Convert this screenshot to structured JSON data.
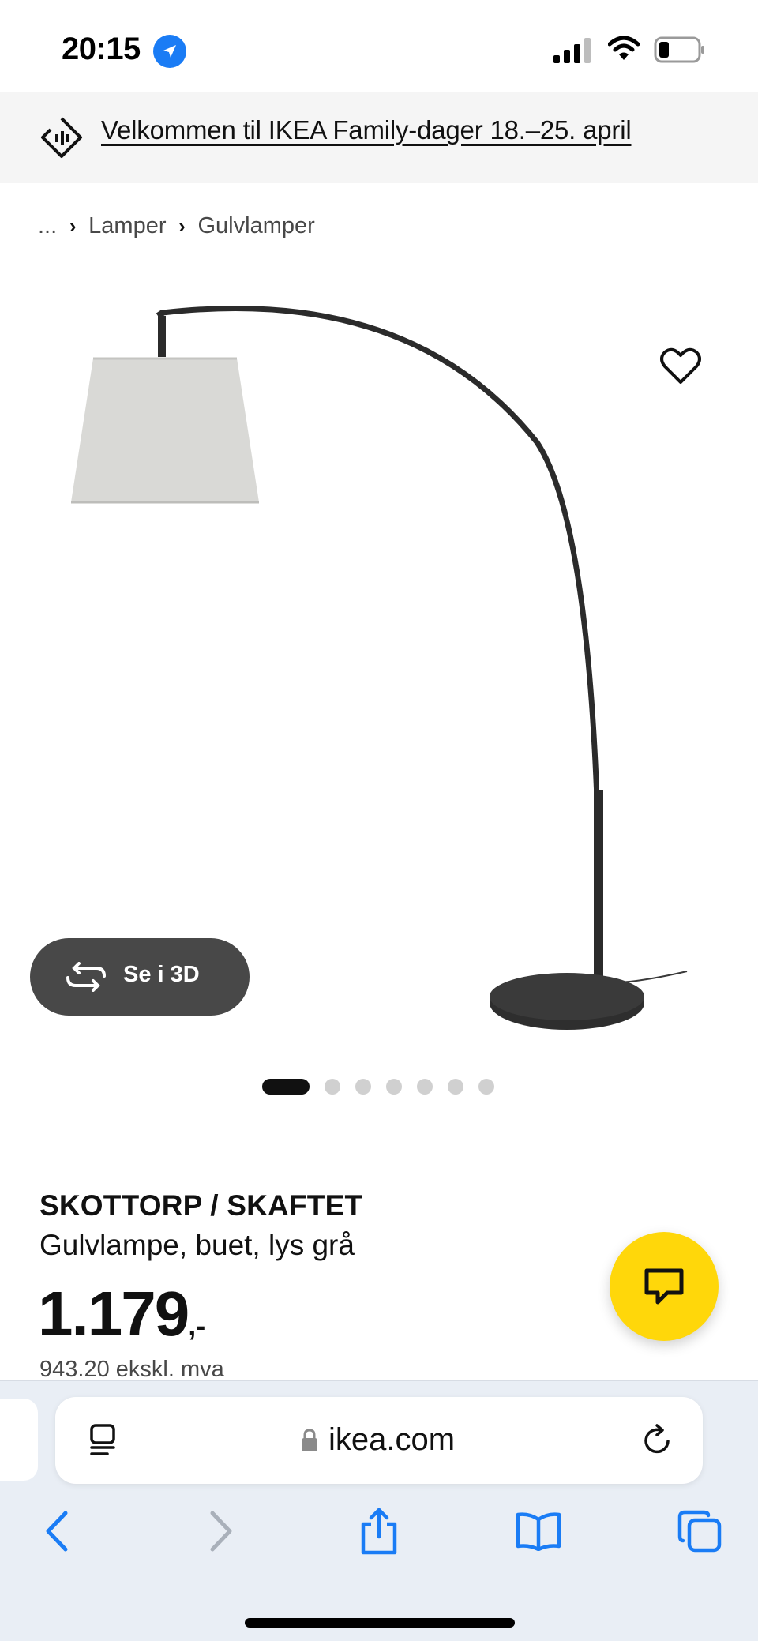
{
  "status_bar": {
    "time": "20:15",
    "icons": [
      "location-arrow-icon",
      "cellular-signal-icon",
      "wifi-icon",
      "battery-icon"
    ]
  },
  "promo": {
    "text": "Velkommen til IKEA Family-dager 18.–25. april",
    "icon": "ikea-family-tag-icon"
  },
  "breadcrumb": {
    "items": [
      "...",
      "Lamper",
      "Gulvlamper"
    ],
    "separator_icon": "chevron-right-icon"
  },
  "product_image": {
    "favorite_icon": "heart-icon",
    "view_3d_label": "Se i 3D",
    "view_3d_icon": "rotate-3d-icon",
    "carousel": {
      "count": 7,
      "active_index": 0
    }
  },
  "product": {
    "name": "SKOTTORP / SKAFTET",
    "description": "Gulvlampe, buet, lys grå",
    "price": "1.179",
    "price_suffix": ",-",
    "price_ex_vat": "943.20 ekskl. mva"
  },
  "chat": {
    "icon": "chat-bubble-icon",
    "color": "#ffd70a"
  },
  "safari": {
    "url": "ikea.com",
    "icons": [
      "reader-icon",
      "lock-icon",
      "reload-icon",
      "back-icon",
      "forward-icon",
      "share-icon",
      "bookmarks-icon",
      "tabs-icon"
    ]
  },
  "colors": {
    "accent_blue": "#1a7cf5",
    "ikea_yellow": "#ffd70a",
    "button_dark": "#484848"
  }
}
